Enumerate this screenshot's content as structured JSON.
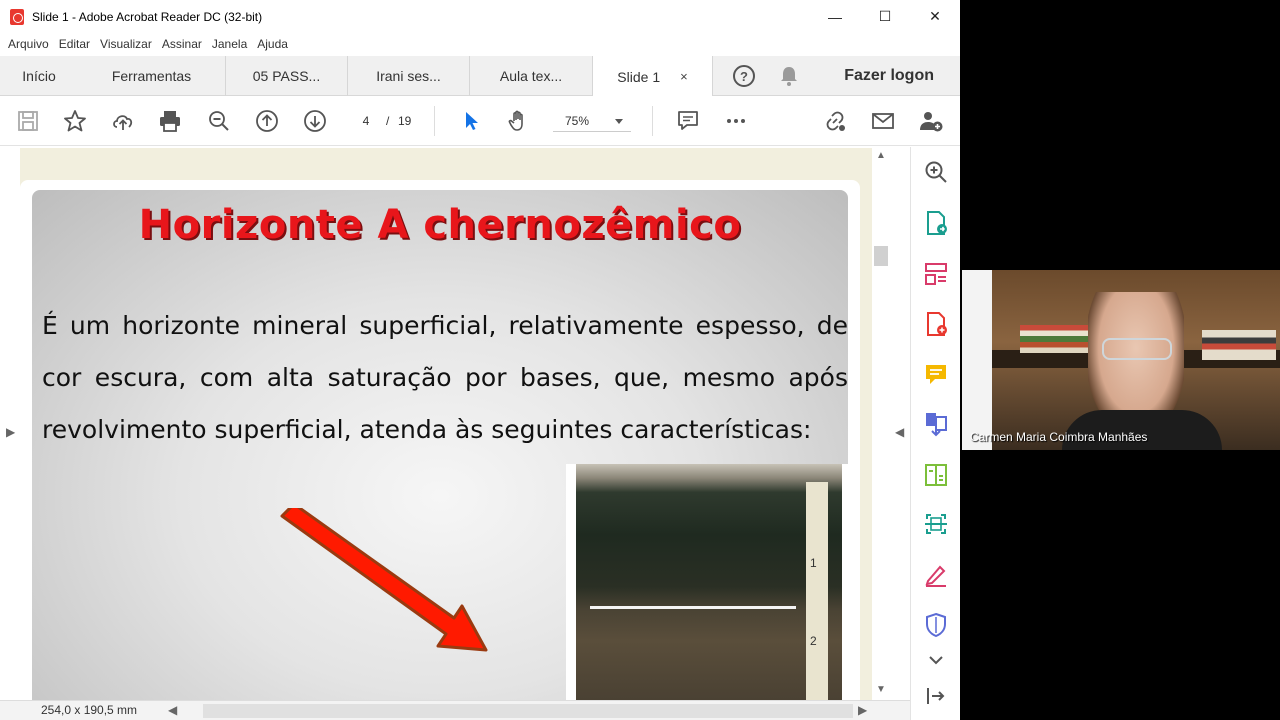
{
  "window": {
    "title": "Slide 1 - Adobe Acrobat Reader DC (32-bit)",
    "minimize": "—",
    "maximize": "☐",
    "close": "✕"
  },
  "menu": [
    "Arquivo",
    "Editar",
    "Visualizar",
    "Assinar",
    "Janela",
    "Ajuda"
  ],
  "tabs": [
    {
      "label": "Início"
    },
    {
      "label": "Ferramentas"
    },
    {
      "label": "05 PASS..."
    },
    {
      "label": "Irani ses..."
    },
    {
      "label": "Aula tex..."
    },
    {
      "label": "Slide 1",
      "close": "×",
      "active": true
    }
  ],
  "tabbar": {
    "help": "?",
    "logon": "Fazer logon"
  },
  "toolbar": {
    "icons": [
      "save-icon",
      "star-icon",
      "upload-icon",
      "print-icon",
      "zoom-out-icon",
      "page-up-icon",
      "page-down-icon",
      "select-cursor-icon",
      "hand-icon",
      "comment-icon",
      "more-icon",
      "link-icon",
      "mail-icon",
      "add-user-icon"
    ],
    "page_current": "4",
    "page_sep": "/",
    "page_total": "19",
    "zoom": "75%"
  },
  "slide": {
    "title": "Horizonte A chernozêmico",
    "body": "É um horizonte mineral superficial, relativamente espesso, de cor escura, com alta saturação por bases, que, mesmo após revolvimento superficial, atenda às seguintes características:",
    "ruler_marks": [
      "1",
      "2"
    ]
  },
  "statusbar": {
    "page_size": "254,0 x 190,5 mm"
  },
  "video": {
    "participant": "Carmen Maria Coimbra Manhães"
  },
  "colors": {
    "title_red": "#e8161b",
    "arrow_red": "#ff1a00",
    "canvas_bg": "#f2efde",
    "accent_blue": "#1473e6",
    "tool_teal": "#1a9e8f"
  }
}
